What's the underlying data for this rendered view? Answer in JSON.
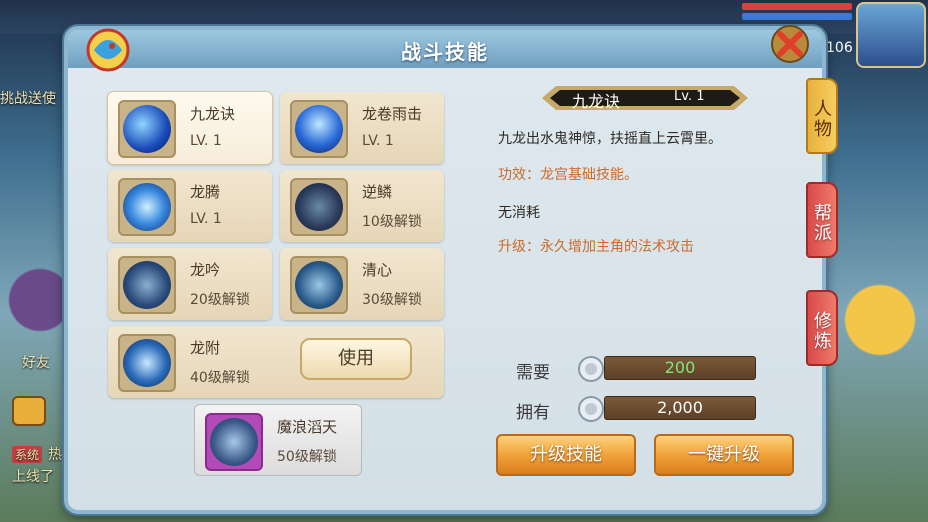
{
  "background": {
    "level_value": "106",
    "left_text_1": "挑战送使",
    "left_text_2": "好友",
    "chat_line_tag": "系统",
    "chat_line_text": "热 欢迎尊贵的",
    "chat_line_text_2": "上线了"
  },
  "dialog": {
    "title": "战斗技能",
    "close_icon": "close-x-icon"
  },
  "skills": [
    {
      "name": "九龙诀",
      "sub": "LV. 1",
      "selected": true
    },
    {
      "name": "龙卷雨击",
      "sub": "LV. 1"
    },
    {
      "name": "龙腾",
      "sub": "LV. 1"
    },
    {
      "name": "逆鳞",
      "sub": "10级解锁"
    },
    {
      "name": "龙吟",
      "sub": "20级解锁"
    },
    {
      "name": "清心",
      "sub": "30级解锁"
    },
    {
      "name": "龙附",
      "sub": "40级解锁"
    }
  ],
  "use_button": "使用",
  "special_skill": {
    "name": "魔浪滔天",
    "sub": "50级解锁"
  },
  "detail": {
    "name": "九龙诀",
    "level": "Lv. 1",
    "description": "九龙出水鬼神惊，扶摇直上云霄里。",
    "effect": "功效：龙宫基础技能。",
    "cost": "无消耗",
    "upgrade": "升级：永久增加主角的法术攻击"
  },
  "resources": {
    "need_label": "需要",
    "need_value": "200",
    "have_label": "拥有",
    "have_value": "2,000",
    "coin_icon": "silver-coin-icon"
  },
  "actions": {
    "upgrade_label": "升级技能",
    "one_click_label": "一键升级"
  },
  "side_tabs": [
    {
      "label": "人物",
      "active": true
    },
    {
      "label": "帮派"
    },
    {
      "label": "修炼"
    }
  ],
  "colors": {
    "need_value": "#7ee87a",
    "orange_text": "#cc6a2a",
    "button_orange": "#f0a23a",
    "tab_gold": "#e8b23a",
    "tab_red": "#d94a4a"
  }
}
